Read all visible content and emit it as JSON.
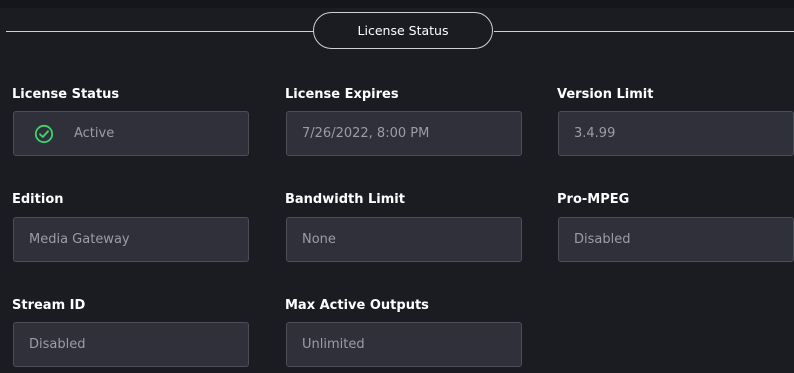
{
  "section": {
    "title": "License Status"
  },
  "fields": {
    "license_status": {
      "label": "License Status",
      "value": "Active",
      "icon": "check-circle-icon",
      "icon_color": "#3ed36b"
    },
    "license_expires": {
      "label": "License Expires",
      "value": "7/26/2022, 8:00 PM"
    },
    "version_limit": {
      "label": "Version Limit",
      "value": "3.4.99"
    },
    "edition": {
      "label": "Edition",
      "value": "Media Gateway"
    },
    "bandwidth_limit": {
      "label": "Bandwidth Limit",
      "value": "None"
    },
    "pro_mpeg": {
      "label": "Pro-MPEG",
      "value": "Disabled"
    },
    "stream_id": {
      "label": "Stream ID",
      "value": "Disabled"
    },
    "max_active_outputs": {
      "label": "Max Active Outputs",
      "value": "Unlimited"
    }
  },
  "colors": {
    "background": "#1b1c22",
    "field_background": "#2f3039",
    "field_border": "#4b4d57",
    "value_text": "#9b9da6",
    "accent_green": "#3ed36b"
  }
}
